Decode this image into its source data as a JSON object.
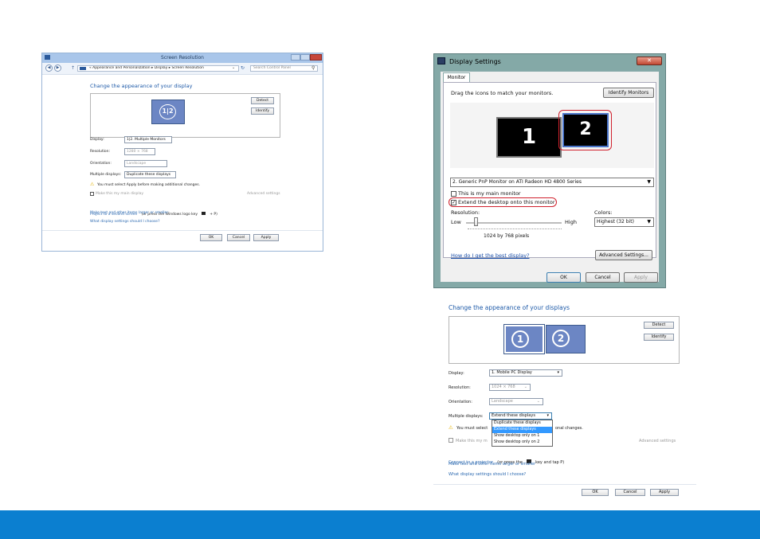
{
  "win8": {
    "title": "Screen Resolution",
    "breadcrumb": "«  Appearance and Personalization  ▸  Display  ▸  Screen Resolution",
    "search_placeholder": "Search Control Panel",
    "heading": "Change the appearance of your display",
    "detect": "Detect",
    "identify": "Identify",
    "monitor_label": "1|2",
    "display_label": "Display:",
    "display_value": "1|2. Multiple Monitors",
    "resolution_label": "Resolution:",
    "resolution_value": "1280 × 768",
    "orientation_label": "Orientation:",
    "orientation_value": "Landscape",
    "multiple_label": "Multiple displays:",
    "multiple_value": "Duplicate these displays",
    "warning": "You must select Apply before making additional changes.",
    "main_monitor": "Make this my main display",
    "advanced": "Advanced settings",
    "link1": "Project to a second screen",
    "link1_suffix": "(or press the Windows logo key",
    "link1_end": "+ P)",
    "link2": "Make text and other items larger or smaller",
    "link3": "What display settings should I choose?",
    "ok": "OK",
    "cancel": "Cancel",
    "apply": "Apply"
  },
  "vista": {
    "title": "Display Settings",
    "tab": "Monitor",
    "instruction": "Drag the icons to match your monitors.",
    "identify": "Identify Monitors",
    "monitor1": "1",
    "monitor2": "2",
    "monitor_select": "2. Generic PnP Monitor on ATI Radeon HD 4800 Series",
    "main_monitor": "This is my main monitor",
    "extend": "Extend the desktop onto this monitor",
    "extend_checked": true,
    "resolution_label": "Resolution:",
    "low": "Low",
    "high": "High",
    "resolution_value": "1024 by 768 pixels",
    "slider_level": 0.1,
    "colors_label": "Colors:",
    "colors_value": "Highest (32 bit)",
    "help_link": "How do I get the best display?",
    "advanced": "Advanced Settings...",
    "ok": "OK",
    "cancel": "Cancel",
    "apply": "Apply",
    "highlight_color": "#d0212d"
  },
  "win7": {
    "heading": "Change the appearance of your displays",
    "detect": "Detect",
    "identify": "Identify",
    "monitor1": "1",
    "monitor2": "2",
    "display_label": "Display:",
    "display_value": "1. Mobile PC Display",
    "resolution_label": "Resolution:",
    "resolution_value": "1024 × 768",
    "orientation_label": "Orientation:",
    "orientation_value": "Landscape",
    "multiple_label": "Multiple displays:",
    "multiple_value": "Extend these displays",
    "options": [
      "Duplicate these displays",
      "Extend these displays",
      "Show desktop only on 1",
      "Show desktop only on 2"
    ],
    "selected_option": 1,
    "warning_start": "You must select",
    "warning_end": "onal changes.",
    "main_monitor": "Make this my m",
    "advanced": "Advanced settings",
    "link1": "Connect to a projector",
    "link1_suffix": "(or press the",
    "link1_end": "key and tap P)",
    "link2": "Make text and other items larger or smaller",
    "link3": "What display settings should I choose?",
    "ok": "OK",
    "cancel": "Cancel",
    "apply": "Apply"
  },
  "colors": {
    "footer": "#0b7fd0",
    "link": "#2d6ab1",
    "selection": "#3399ff"
  }
}
